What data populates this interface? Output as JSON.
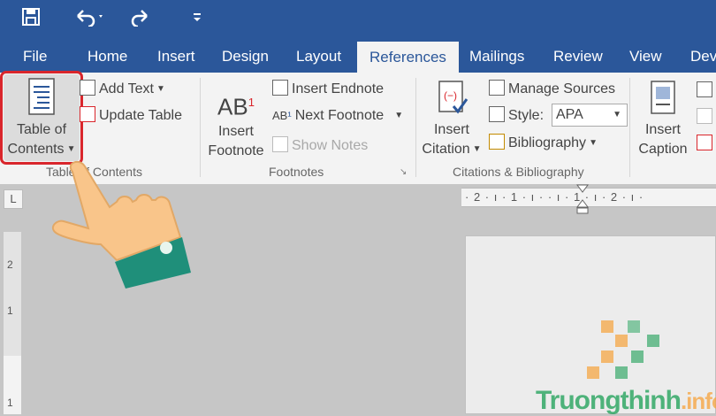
{
  "qat": {
    "save_icon": "save-icon",
    "undo_icon": "undo-icon",
    "redo_icon": "redo-icon",
    "customize_icon": "customize-icon"
  },
  "tabs": [
    {
      "label": "File"
    },
    {
      "label": "Home"
    },
    {
      "label": "Insert"
    },
    {
      "label": "Design"
    },
    {
      "label": "Layout"
    },
    {
      "label": "References",
      "active": true
    },
    {
      "label": "Mailings"
    },
    {
      "label": "Review"
    },
    {
      "label": "View"
    },
    {
      "label": "Dev"
    }
  ],
  "ribbon": {
    "toc": {
      "line1": "Table of",
      "line2": "Contents",
      "add_text": "Add Text",
      "update_table": "Update Table",
      "group_label": "Table of Contents"
    },
    "footnotes": {
      "insert_line1": "Insert",
      "insert_line2": "Footnote",
      "ab_label": "AB",
      "insert_endnote": "Insert Endnote",
      "next_footnote": "Next Footnote",
      "show_notes": "Show Notes",
      "group_label": "Footnotes"
    },
    "citations": {
      "insert_line1": "Insert",
      "insert_line2": "Citation",
      "manage_sources": "Manage Sources",
      "style_label": "Style:",
      "style_value": "APA",
      "bibliography": "Bibliography",
      "group_label": "Citations & Bibliography"
    },
    "captions": {
      "insert_line1": "Insert",
      "insert_line2": "Caption"
    }
  },
  "ruler": {
    "corner": "L",
    "horizontal_text": "· 2 · ı · 1 · ı ·   · ı · 1 · ı · 2 · ı ·",
    "vertical_ticks": [
      "2",
      "1",
      "1"
    ]
  },
  "watermark": {
    "name": "Truongthinh",
    "tld": ".info"
  },
  "colors": {
    "accent": "#2b579a",
    "highlight": "#d9262c",
    "hand_skin": "#f9c58a",
    "sleeve": "#1f8f7a"
  }
}
